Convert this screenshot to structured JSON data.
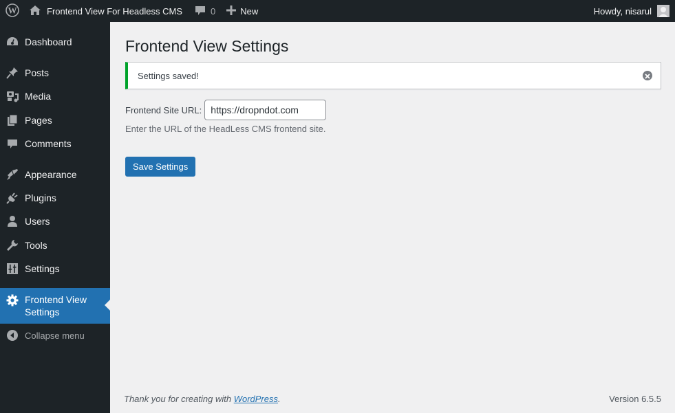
{
  "adminbar": {
    "site_name": "Frontend View For Headless CMS",
    "comments_count": "0",
    "new_label": "New",
    "greeting": "Howdy, nisarul"
  },
  "sidebar": {
    "items": [
      {
        "label": "Dashboard",
        "icon": "dashboard-icon"
      },
      {
        "label": "Posts",
        "icon": "pushpin-icon"
      },
      {
        "label": "Media",
        "icon": "media-icon"
      },
      {
        "label": "Pages",
        "icon": "pages-icon"
      },
      {
        "label": "Comments",
        "icon": "comment-icon"
      },
      {
        "label": "Appearance",
        "icon": "paintbrush-icon"
      },
      {
        "label": "Plugins",
        "icon": "plug-icon"
      },
      {
        "label": "Users",
        "icon": "user-icon"
      },
      {
        "label": "Tools",
        "icon": "wrench-icon"
      },
      {
        "label": "Settings",
        "icon": "sliders-icon"
      },
      {
        "label": "Frontend View Settings",
        "icon": "gear-icon",
        "current": true
      }
    ],
    "collapse_label": "Collapse menu"
  },
  "main": {
    "title": "Frontend View Settings",
    "notice": "Settings saved!",
    "field_label": "Frontend Site URL:",
    "field_value": "https://dropndot.com",
    "field_description": "Enter the URL of the HeadLess CMS frontend site.",
    "save_label": "Save Settings"
  },
  "footer": {
    "thanks_prefix": "Thank you for creating with ",
    "thanks_link": "WordPress",
    "thanks_suffix": ".",
    "version": "Version 6.5.5"
  },
  "colors": {
    "accent": "#2271b1",
    "success": "#00a32a",
    "adminbar_bg": "#1d2327"
  }
}
